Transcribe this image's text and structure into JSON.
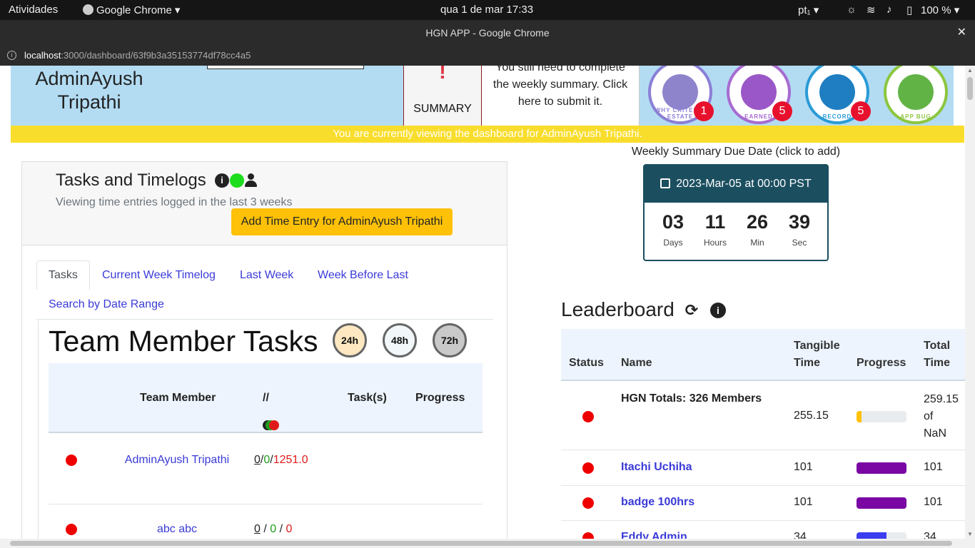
{
  "system": {
    "activities": "Atividades",
    "app_menu": "Google Chrome",
    "datetime": "qua 1 de mar  17:33",
    "keyboard": "pt₁",
    "battery": "100 %"
  },
  "window": {
    "title": "HGN APP - Google Chrome",
    "close": "✕"
  },
  "url": {
    "host": "localhost",
    "path": ":3000/dashboard/63f9b3a35153774df78cc4a5"
  },
  "profile": {
    "name": "AdminAyush Tripathi",
    "summary_mark": "!",
    "summary_label": "SUMMARY",
    "summary_message": "You still need to complete the weekly summary. Click here to submit it.",
    "badges": [
      {
        "ring_text": "WHY CRITERIA ESTATE",
        "count": "1",
        "color": "#8b7fd6",
        "core": "#8e84cc",
        "icon": "checkbox-badge-icon"
      },
      {
        "ring_text": "EARNED",
        "count": "5",
        "color": "#a76bd1",
        "core": "#9a57c7",
        "icon": "ribbon-badge-icon"
      },
      {
        "ring_text": "RECORD",
        "count": "5",
        "color": "#2a9bd6",
        "core": "#1f7ec2",
        "icon": "square-badge-icon"
      },
      {
        "ring_text": "APP BUG",
        "count": "",
        "color": "#8cc63f",
        "core": "#62b346",
        "icon": "bug-badge-icon"
      }
    ]
  },
  "viewing_notice": "You are currently viewing the dashboard for AdminAyush Tripathi.",
  "tasks_panel": {
    "title": "Tasks and Timelogs",
    "subtitle": "Viewing time entries logged in the last 3 weeks",
    "add_button": "Add Time Entry for AdminAyush Tripathi",
    "tabs": [
      "Tasks",
      "Current Week Timelog",
      "Last Week",
      "Week Before Last",
      "Search by Date Range"
    ],
    "icons": {
      "info": "info-icon",
      "status": "green-status-icon",
      "user": "user-icon"
    }
  },
  "team_tasks": {
    "title": "Team Member Tasks",
    "filters": [
      {
        "label": "24h",
        "bg": "#fde8c2"
      },
      {
        "label": "48h",
        "bg": "#f2f7f9"
      },
      {
        "label": "72h",
        "bg": "#c9c9c9"
      }
    ],
    "columns": {
      "member": "Team Member",
      "sep": "/",
      "tasks": "Task(s)",
      "progress": "Progress"
    },
    "rows": [
      {
        "name": "AdminAyush Tripathi",
        "h1": "0",
        "h2": "0",
        "h3": "1251.0",
        "sep": "/"
      },
      {
        "name": "abc abc",
        "h1": "0",
        "h2": "0",
        "h3": "0",
        "sep": " / "
      }
    ]
  },
  "due": {
    "label": "Weekly Summary Due Date (click to add)",
    "date": "2023-Mar-05 at 00:00 PST",
    "countdown": [
      {
        "value": "03",
        "unit": "Days"
      },
      {
        "value": "11",
        "unit": "Hours"
      },
      {
        "value": "26",
        "unit": "Min"
      },
      {
        "value": "39",
        "unit": "Sec"
      }
    ]
  },
  "leaderboard": {
    "title": "Leaderboard",
    "columns": {
      "status": "Status",
      "name": "Name",
      "tangible_1": "Tangible",
      "tangible_2": "Time",
      "progress": "Progress",
      "total_1": "Total",
      "total_2": "Time"
    },
    "totals": {
      "label": "HGN Totals: 326 Members",
      "tangible": "255.15",
      "total_1": "259.15",
      "total_2": "of",
      "total_3": "NaN",
      "progress": 0.1,
      "color": "#ffc107"
    },
    "rows": [
      {
        "name": "Itachi Uchiha",
        "tangible": "101",
        "total": "101",
        "progress": 1.0,
        "color": "#7a06a3"
      },
      {
        "name": "badge 100hrs",
        "tangible": "101",
        "total": "101",
        "progress": 1.0,
        "color": "#7a06a3"
      },
      {
        "name": "Eddy Admin",
        "tangible": "34",
        "total": "34",
        "progress": 0.6,
        "color": "#3d3df0"
      }
    ]
  }
}
